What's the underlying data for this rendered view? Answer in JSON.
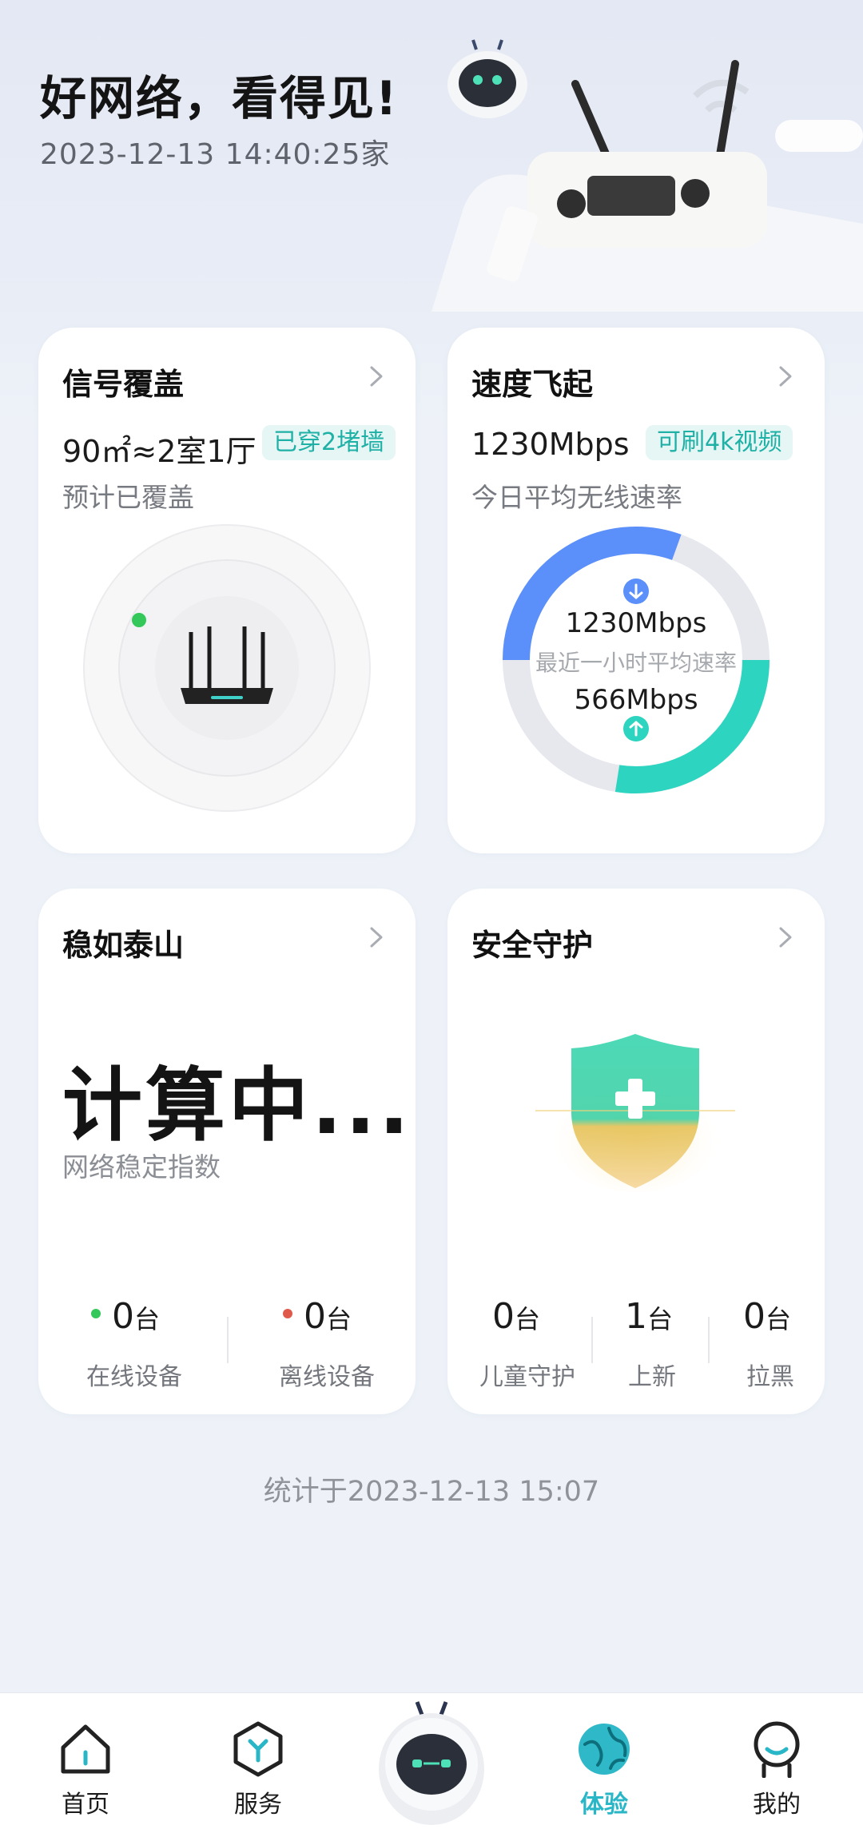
{
  "header": {
    "title": "好网络，看得见!",
    "datetime": "2023-12-13 14:40:25家"
  },
  "cards": {
    "coverage": {
      "title": "信号覆盖",
      "main": "90㎡≈2室1厅",
      "tag": "已穿2堵墙",
      "sub": "预计已覆盖"
    },
    "speed": {
      "title": "速度飞起",
      "main": "1230Mbps",
      "tag": "可刷4k视频",
      "sub": "今日平均无线速率",
      "download": "1230Mbps",
      "upload": "566Mbps",
      "center_label": "最近一小时平均速率",
      "download_fraction": 0.5,
      "upload_fraction": 0.5
    },
    "stability": {
      "title": "稳如泰山",
      "big": "计算中...",
      "sub": "网络稳定指数",
      "online_count": "0",
      "online_unit": "台",
      "online_label": "在线设备",
      "offline_count": "0",
      "offline_unit": "台",
      "offline_label": "离线设备"
    },
    "security": {
      "title": "安全守护",
      "child_count": "0",
      "child_unit": "台",
      "child_label": "儿童守护",
      "new_count": "1",
      "new_unit": "台",
      "new_label": "上新",
      "block_count": "0",
      "block_unit": "台",
      "block_label": "拉黑"
    }
  },
  "footer": {
    "stat_text": "统计于2023-12-13  15:07"
  },
  "tabbar": {
    "home": "首页",
    "service": "服务",
    "experience": "体验",
    "mine": "我的"
  },
  "colors": {
    "accent_teal": "#29b6c7",
    "download_blue": "#5b8ff9",
    "upload_teal": "#2dd4bf",
    "online_dot": "#34c759",
    "offline_dot": "#e05a4b"
  }
}
